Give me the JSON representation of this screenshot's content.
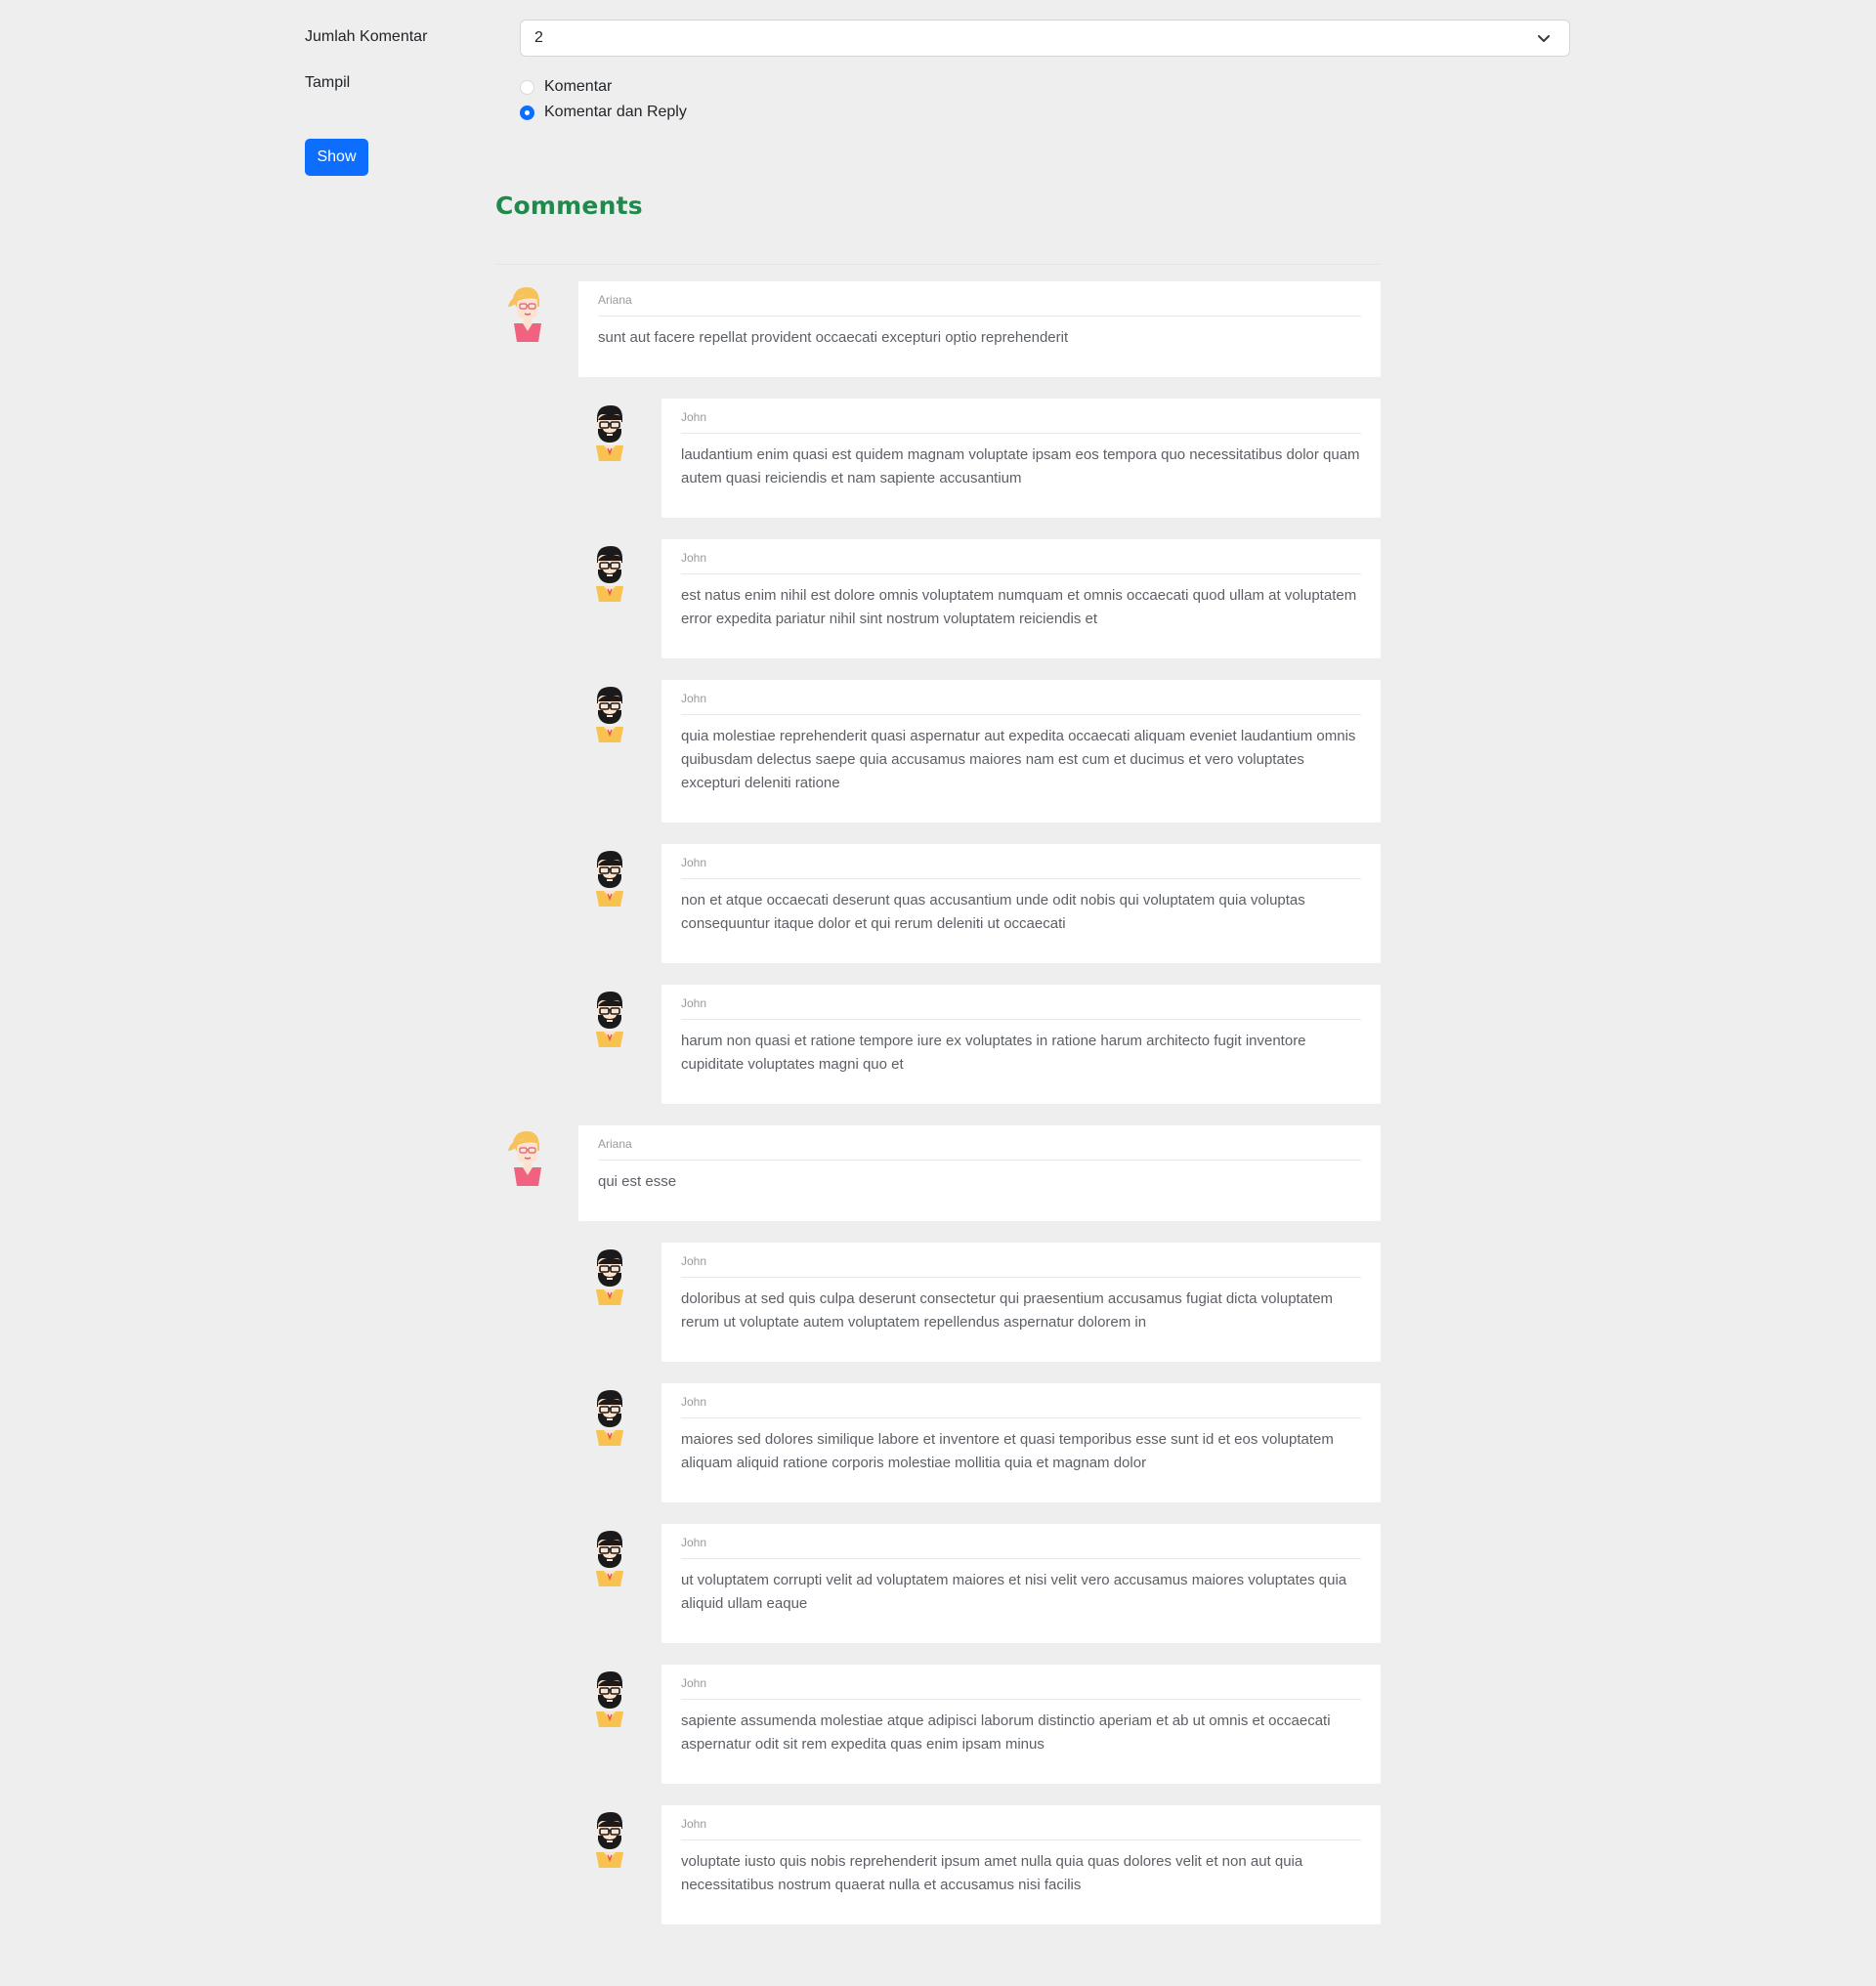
{
  "form": {
    "count_label": "Jumlah Komentar",
    "count_value": "2",
    "display_label": "Tampil",
    "options": [
      {
        "label": "Komentar",
        "checked": false
      },
      {
        "label": "Komentar dan Reply",
        "checked": true
      }
    ],
    "show_label": "Show"
  },
  "heading": "Comments",
  "colors": {
    "accent": "#0d6efd",
    "heading": "#1f8a4c"
  },
  "threads": [
    {
      "author": "Ariana",
      "text": "sunt aut facere repellat provident occaecati excepturi optio reprehenderit",
      "replies": [
        {
          "author": "John",
          "text": "laudantium enim quasi est quidem magnam voluptate ipsam eos tempora quo necessitatibus dolor quam autem quasi reiciendis et nam sapiente accusantium"
        },
        {
          "author": "John",
          "text": "est natus enim nihil est dolore omnis voluptatem numquam et omnis occaecati quod ullam at voluptatem error expedita pariatur nihil sint nostrum voluptatem reiciendis et"
        },
        {
          "author": "John",
          "text": "quia molestiae reprehenderit quasi aspernatur aut expedita occaecati aliquam eveniet laudantium omnis quibusdam delectus saepe quia accusamus maiores nam est cum et ducimus et vero voluptates excepturi deleniti ratione"
        },
        {
          "author": "John",
          "text": "non et atque occaecati deserunt quas accusantium unde odit nobis qui voluptatem quia voluptas consequuntur itaque dolor et qui rerum deleniti ut occaecati"
        },
        {
          "author": "John",
          "text": "harum non quasi et ratione tempore iure ex voluptates in ratione harum architecto fugit inventore cupiditate voluptates magni quo et"
        }
      ]
    },
    {
      "author": "Ariana",
      "text": "qui est esse",
      "replies": [
        {
          "author": "John",
          "text": "doloribus at sed quis culpa deserunt consectetur qui praesentium accusamus fugiat dicta voluptatem rerum ut voluptate autem voluptatem repellendus aspernatur dolorem in"
        },
        {
          "author": "John",
          "text": "maiores sed dolores similique labore et inventore et quasi temporibus esse sunt id et eos voluptatem aliquam aliquid ratione corporis molestiae mollitia quia et magnam dolor"
        },
        {
          "author": "John",
          "text": "ut voluptatem corrupti velit ad voluptatem maiores et nisi velit vero accusamus maiores voluptates quia aliquid ullam eaque"
        },
        {
          "author": "John",
          "text": "sapiente assumenda molestiae atque adipisci laborum distinctio aperiam et ab ut omnis et occaecati aspernatur odit sit rem expedita quas enim ipsam minus"
        },
        {
          "author": "John",
          "text": "voluptate iusto quis nobis reprehenderit ipsum amet nulla quia quas dolores velit et non aut quia necessitatibus nostrum quaerat nulla et accusamus nisi facilis"
        }
      ]
    }
  ]
}
